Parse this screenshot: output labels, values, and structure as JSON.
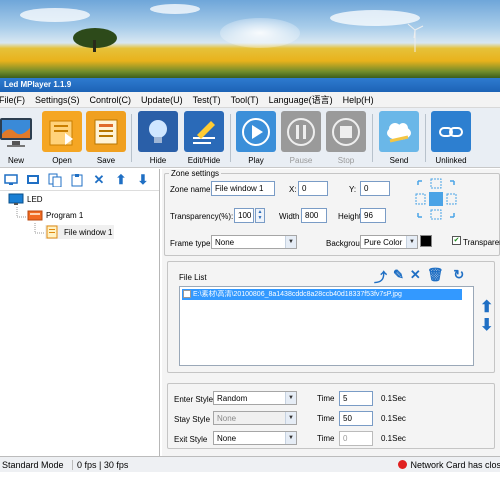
{
  "window": {
    "title": "Led MPlayer 1.1.9"
  },
  "menu": [
    "File(F)",
    "Settings(S)",
    "Control(C)",
    "Update(U)",
    "Test(T)",
    "Tool(T)",
    "Language(语言)",
    "Help(H)"
  ],
  "toolbar": {
    "new": "New",
    "open": "Open",
    "save": "Save",
    "hide": "Hide",
    "edit_hide": "Edit/Hide",
    "play": "Play",
    "pause": "Pause",
    "stop": "Stop",
    "send": "Send",
    "unlinked": "Unlinked"
  },
  "tree": {
    "root": "LED",
    "program": "Program 1",
    "window": "File window 1"
  },
  "zone": {
    "legend": "Zone settings",
    "name_label": "Zone name",
    "name_value": "File window 1",
    "x_label": "X:",
    "x_value": "0",
    "y_label": "Y:",
    "y_value": "0",
    "transparency_label": "Transparency(%):",
    "transparency_value": "100",
    "width_label": "Width",
    "width_value": "800",
    "height_label": "Height",
    "height_value": "96",
    "frame_label": "Frame type",
    "frame_value": "None",
    "bg_label": "Backgroud",
    "bg_value": "Pure Color",
    "transparent_label": "Transparent",
    "bg_color": "#000000"
  },
  "filelist": {
    "label": "File List",
    "items": [
      "E:\\素材\\高清\\20100806_8a1438cddc8a28ccb40d18337f53fv7sP.jpg"
    ]
  },
  "effects": {
    "enter_label": "Enter Style",
    "enter_value": "Random",
    "stay_label": "Stay Style",
    "stay_value": "None",
    "exit_label": "Exit Style",
    "exit_value": "None",
    "time_label": "Time",
    "enter_time": "5",
    "stay_time": "50",
    "exit_time": "0",
    "unit": "0.1Sec"
  },
  "status": {
    "mode": "Standard Mode",
    "fps": "0 fps | 30 fps",
    "network": "Network Card has close"
  },
  "colors": {
    "accent": "#1d63b5",
    "selection": "#3399ff",
    "error": "#e02020"
  }
}
